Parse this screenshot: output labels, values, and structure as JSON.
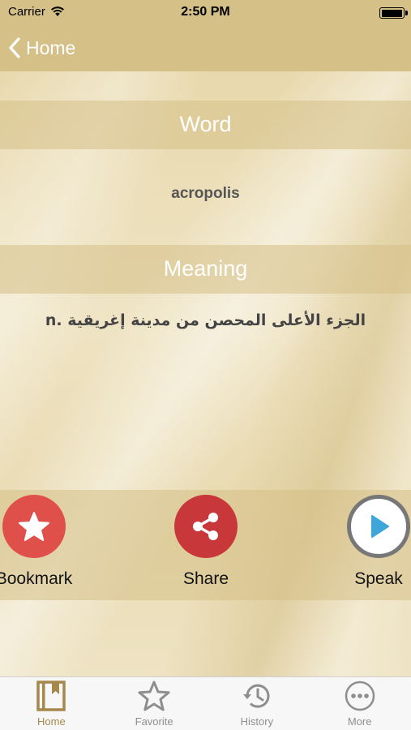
{
  "status_bar": {
    "carrier": "Carrier",
    "time": "2:50 PM"
  },
  "nav": {
    "back_label": "Home"
  },
  "word_section": {
    "header": "Word",
    "value": "acropolis"
  },
  "meaning_section": {
    "header": "Meaning",
    "value": "الجزء الأعلى المحصن من مدينة إغريقية .n"
  },
  "actions": {
    "bookmark": "Bookmark",
    "share": "Share",
    "speak": "Speak"
  },
  "tabs": [
    {
      "label": "Home",
      "icon": "book-icon",
      "active": true
    },
    {
      "label": "Favorite",
      "icon": "star-icon",
      "active": false
    },
    {
      "label": "History",
      "icon": "history-icon",
      "active": false
    },
    {
      "label": "More",
      "icon": "more-icon",
      "active": false
    }
  ],
  "colors": {
    "bar_gold": "#d5c088",
    "bookmark_red": "#e0504a",
    "share_red": "#c8383a",
    "speak_blue": "#3ea6d8",
    "active_tab": "#a5884a"
  }
}
